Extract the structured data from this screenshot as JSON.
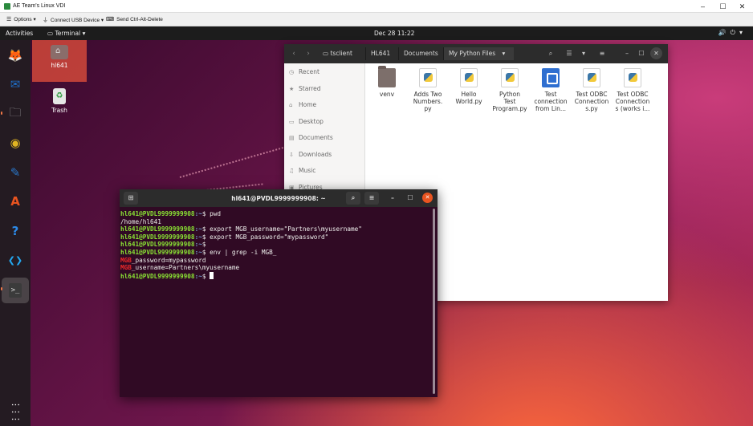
{
  "vdi": {
    "window_title": "AE Team's Linux VDI",
    "controls": {
      "minimize": "–",
      "maximize": "☐",
      "close": "✕"
    },
    "toolbar": {
      "options_label": "Options",
      "usb_label": "Connect USB Device",
      "cad_label": "Send Ctrl-Alt-Delete"
    }
  },
  "topbar": {
    "activities": "Activities",
    "app_menu": "Terminal",
    "clock": "Dec 28  11:22",
    "system_icons": "🔊⏻▾"
  },
  "dock": {
    "items": [
      {
        "name": "firefox",
        "icon": "🦊",
        "color": "#e86a1b"
      },
      {
        "name": "thunderbird",
        "icon": "✉",
        "color": "#1f6fc9"
      },
      {
        "name": "files",
        "icon": "🗀",
        "color": "#9a9a9a"
      },
      {
        "name": "rhythmbox",
        "icon": "◉",
        "color": "#e0b422"
      },
      {
        "name": "libreoffice-writer",
        "icon": "✎",
        "color": "#2a77c9"
      },
      {
        "name": "ubuntu-software",
        "icon": "A",
        "color": "#e95420"
      },
      {
        "name": "help",
        "icon": "?",
        "color": "#2c8ae8"
      },
      {
        "name": "vscode",
        "icon": "❮❯",
        "color": "#23a9f2"
      },
      {
        "name": "terminal",
        "icon": ">_",
        "color": "#3b3b3b"
      }
    ],
    "show_apps_icon": "⋮⋮⋮"
  },
  "desktop": {
    "icons": [
      {
        "label": "hl641",
        "icon": "home-folder"
      },
      {
        "label": "Trash",
        "icon": "trash"
      }
    ]
  },
  "files": {
    "nav": {
      "back": "‹",
      "forward": "›"
    },
    "breadcrumbs": [
      "tsclient",
      "HL641",
      "Documents",
      "My Python Files"
    ],
    "crumb_dropdown": "▾",
    "header_icons": {
      "search": "⌕",
      "list": "☰",
      "view_options": "▾",
      "menu": "≡",
      "minimize": "–",
      "maximize": "☐",
      "close": "✕"
    },
    "sidebar": [
      {
        "label": "Recent",
        "icon": "◷"
      },
      {
        "label": "Starred",
        "icon": "★"
      },
      {
        "label": "Home",
        "icon": "⌂"
      },
      {
        "label": "Desktop",
        "icon": "▭"
      },
      {
        "label": "Documents",
        "icon": "▤"
      },
      {
        "label": "Downloads",
        "icon": "⇩"
      },
      {
        "label": "Music",
        "icon": "♫"
      },
      {
        "label": "Pictures",
        "icon": "▣"
      }
    ],
    "items": [
      {
        "line1": "venv",
        "line2": "",
        "line3": "",
        "type": "folder"
      },
      {
        "line1": "Adds Two",
        "line2": "Numbers.",
        "line3": "py",
        "type": "python"
      },
      {
        "line1": "Hello",
        "line2": "World.py",
        "line3": "",
        "type": "python"
      },
      {
        "line1": "Python",
        "line2": "Test",
        "line3": "Program.py",
        "type": "python"
      },
      {
        "line1": "Test",
        "line2": "connection",
        "line3": "from Lin...",
        "type": "word"
      },
      {
        "line1": "Test ODBC",
        "line2": "Connection",
        "line3": "s.py",
        "type": "python"
      },
      {
        "line1": "Test ODBC",
        "line2": "Connection",
        "line3": "s (works i...",
        "type": "python"
      }
    ]
  },
  "terminal": {
    "title": "hl641@PVDL9999999908: ~",
    "header_icons": {
      "new_tab": "⊞",
      "search": "⌕",
      "menu": "≡",
      "minimize": "–",
      "maximize": "☐",
      "close": "✕"
    },
    "prompt_user": "hl641@PVDL9999999908",
    "prompt_path": ":~",
    "prompt_symbol": "$ ",
    "lines": [
      {
        "type": "prompt",
        "cmd": "pwd"
      },
      {
        "type": "out",
        "text": "/home/hl641"
      },
      {
        "type": "prompt",
        "cmd": "export MGB_username=\"Partners\\myusername\""
      },
      {
        "type": "prompt",
        "cmd": "export MGB_password=\"mypassword\""
      },
      {
        "type": "prompt",
        "cmd": ""
      },
      {
        "type": "prompt",
        "cmd": "env | grep -i MGB_"
      },
      {
        "type": "hl",
        "hl": "MGB",
        "rest": "_password=mypassword"
      },
      {
        "type": "hl",
        "hl": "MGB",
        "rest": "_username=Partners\\myusername"
      },
      {
        "type": "cursor",
        "cmd": ""
      }
    ]
  }
}
